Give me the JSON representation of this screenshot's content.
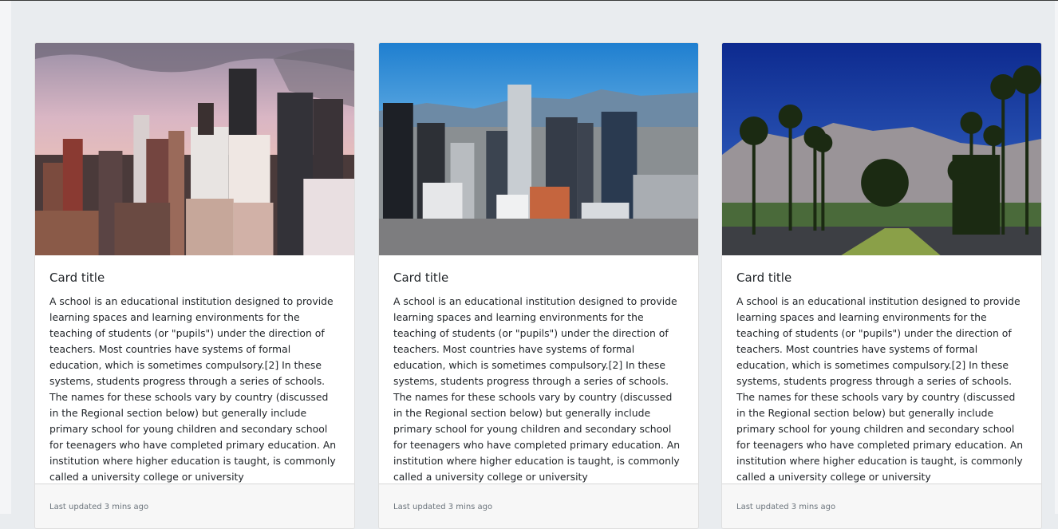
{
  "cards": [
    {
      "image_icon": "city-skyline-dusk-image",
      "title": "Card title",
      "text": "A school is an educational institution designed to provide learning spaces and learning environments for the teaching of students (or \"pupils\") under the direction of teachers. Most countries have systems of formal education, which is sometimes compulsory.[2] In these systems, students progress through a series of schools. The names for these schools vary by country (discussed in the Regional section below) but generally include primary school for young children and secondary school for teenagers who have completed primary education. An institution where higher education is taught, is commonly called a university college or university",
      "footer": "Last updated 3 mins ago"
    },
    {
      "image_icon": "city-skyline-mountains-image",
      "title": "Card title",
      "text": "A school is an educational institution designed to provide learning spaces and learning environments for the teaching of students (or \"pupils\") under the direction of teachers. Most countries have systems of formal education, which is sometimes compulsory.[2] In these systems, students progress through a series of schools. The names for these schools vary by country (discussed in the Regional section below) but generally include primary school for young children and secondary school for teenagers who have completed primary education. An institution where higher education is taught, is commonly called a university college or university",
      "footer": "Last updated 3 mins ago"
    },
    {
      "image_icon": "palm-road-mountains-image",
      "title": "Card title",
      "text": "A school is an educational institution designed to provide learning spaces and learning environments for the teaching of students (or \"pupils\") under the direction of teachers. Most countries have systems of formal education, which is sometimes compulsory.[2] In these systems, students progress through a series of schools. The names for these schools vary by country (discussed in the Regional section below) but generally include primary school for young children and secondary school for teenagers who have completed primary education. An institution where higher education is taught, is commonly called a university college or university",
      "footer": "Last updated 3 mins ago"
    }
  ],
  "colors": {
    "page_background": "#e9ecef",
    "card_background": "#ffffff",
    "footer_background": "#f7f7f7",
    "footer_text": "#6c757d"
  }
}
